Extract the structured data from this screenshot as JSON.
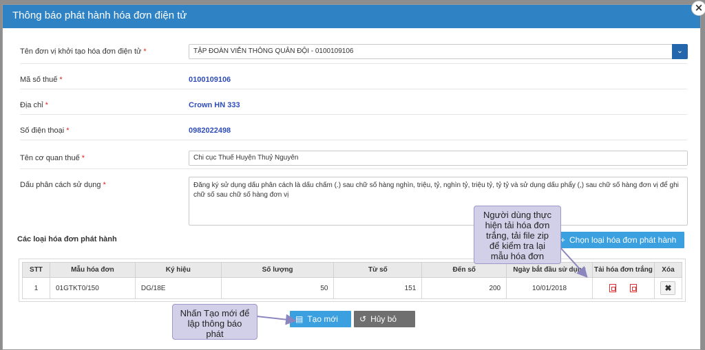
{
  "modal": {
    "title": "Thông báo phát hành hóa đơn điện tử",
    "close_symbol": "×"
  },
  "form": {
    "unit_label": "Tên đơn vị khởi tạo hóa đơn điện tử",
    "unit_value": "TẬP ĐOÀN VIỄN THÔNG QUÂN ĐỘI - 0100109106",
    "tax_code_label": "Mã số thuế",
    "tax_code_value": "0100109106",
    "address_label": "Địa chỉ",
    "address_value": "Crown HN 333",
    "phone_label": "Số điện thoại",
    "phone_value": "0982022498",
    "tax_office_label": "Tên cơ quan thuế",
    "tax_office_value": "Chi cục Thuế Huyện Thuỷ Nguyên",
    "separator_label": "Dấu phân cách sử dụng",
    "separator_value": "Đăng ký sử dụng dấu phân cách là dấu chấm (.) sau chữ số hàng nghìn, triệu, tỷ, nghìn tỷ, triệu tỷ, tỷ tỷ và sử dụng dấu phẩy (,) sau chữ số hàng đơn vị để ghi chữ số sau chữ số hàng đơn vị",
    "required_mark": "*"
  },
  "section": {
    "title": "Các loại hóa đơn phát hành",
    "choose_button": "Chọn loại hóa đơn phát hành",
    "choose_icon": "+"
  },
  "table": {
    "headers": [
      "STT",
      "Mẫu hóa đơn",
      "Ký hiệu",
      "Số lượng",
      "Từ số",
      "Đến số",
      "Ngày bắt đầu sử dụng",
      "Tải hóa đơn trắng",
      "Xóa"
    ],
    "rows": [
      {
        "stt": "1",
        "template": "01GTKT0/150",
        "symbol": "DG/18E",
        "quantity": "50",
        "from": "151",
        "to": "200",
        "start_date": "10/01/2018",
        "delete_symbol": "✖"
      }
    ]
  },
  "buttons": {
    "create": "Tạo mới",
    "cancel": "Hủy bỏ"
  },
  "tooltips": {
    "download": "Người dùng thực hiện tải hóa đơn trắng, tải file zip để kiểm tra lại mẫu hóa đơn",
    "create": "Nhấn Tạo mới để lập thông báo phát"
  },
  "colors": {
    "header": "#2f83c5",
    "primary_button": "#3aa0e0",
    "value_text": "#2f4db8",
    "required": "#d9251c",
    "pdf_icon": "#e12d2d"
  },
  "icons": {
    "close": "close-icon",
    "dropdown": "chevron-down-icon",
    "add": "plus-icon",
    "pdf": "pdf-icon",
    "zip": "zip-file-icon",
    "delete": "close-icon",
    "create": "document-icon",
    "cancel": "undo-icon"
  }
}
